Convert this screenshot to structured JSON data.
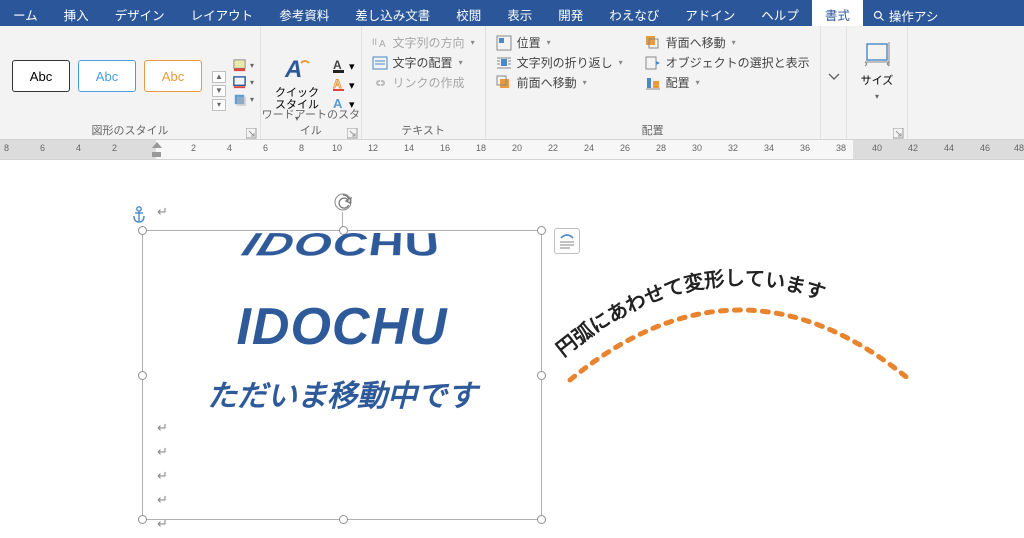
{
  "menubar": {
    "tabs": [
      "ーム",
      "挿入",
      "デザイン",
      "レイアウト",
      "参考資料",
      "差し込み文書",
      "校閲",
      "表示",
      "開発",
      "わえなび",
      "アドイン",
      "ヘルプ",
      "書式"
    ],
    "active_index": 12,
    "tell_me": "操作アシ"
  },
  "ribbon": {
    "shape_styles": {
      "label": "図形のスタイル",
      "gallery": [
        "Abc",
        "Abc",
        "Abc"
      ]
    },
    "wordart": {
      "label": "ワードアートのスタイル",
      "quick_style": "クイック\nスタイル"
    },
    "text": {
      "label": "テキスト",
      "direction": "文字列の方向",
      "align": "文字の配置",
      "link": "リンクの作成"
    },
    "arrange": {
      "label": "配置",
      "position": "位置",
      "wrap": "文字列の折り返し",
      "forward": "前面へ移動",
      "backward": "背面へ移動",
      "selection_pane": "オブジェクトの選択と表示",
      "align_cmd": "配置"
    },
    "size": {
      "label": "サイズ"
    }
  },
  "ruler": {
    "left_numbers": [
      "8",
      "6",
      "4",
      "2"
    ],
    "right_numbers": [
      "2",
      "4",
      "6",
      "8",
      "10",
      "12",
      "14",
      "16",
      "18",
      "20",
      "22",
      "24",
      "26",
      "28",
      "30",
      "32",
      "34",
      "36",
      "38",
      "40",
      "42",
      "44",
      "46",
      "48"
    ]
  },
  "document": {
    "wordart_top": "IDOCHU",
    "wordart_mid": "IDOCHU",
    "wordart_bottom": "ただいま移動中です",
    "arc_text": "円弧にあわせて変形しています"
  }
}
